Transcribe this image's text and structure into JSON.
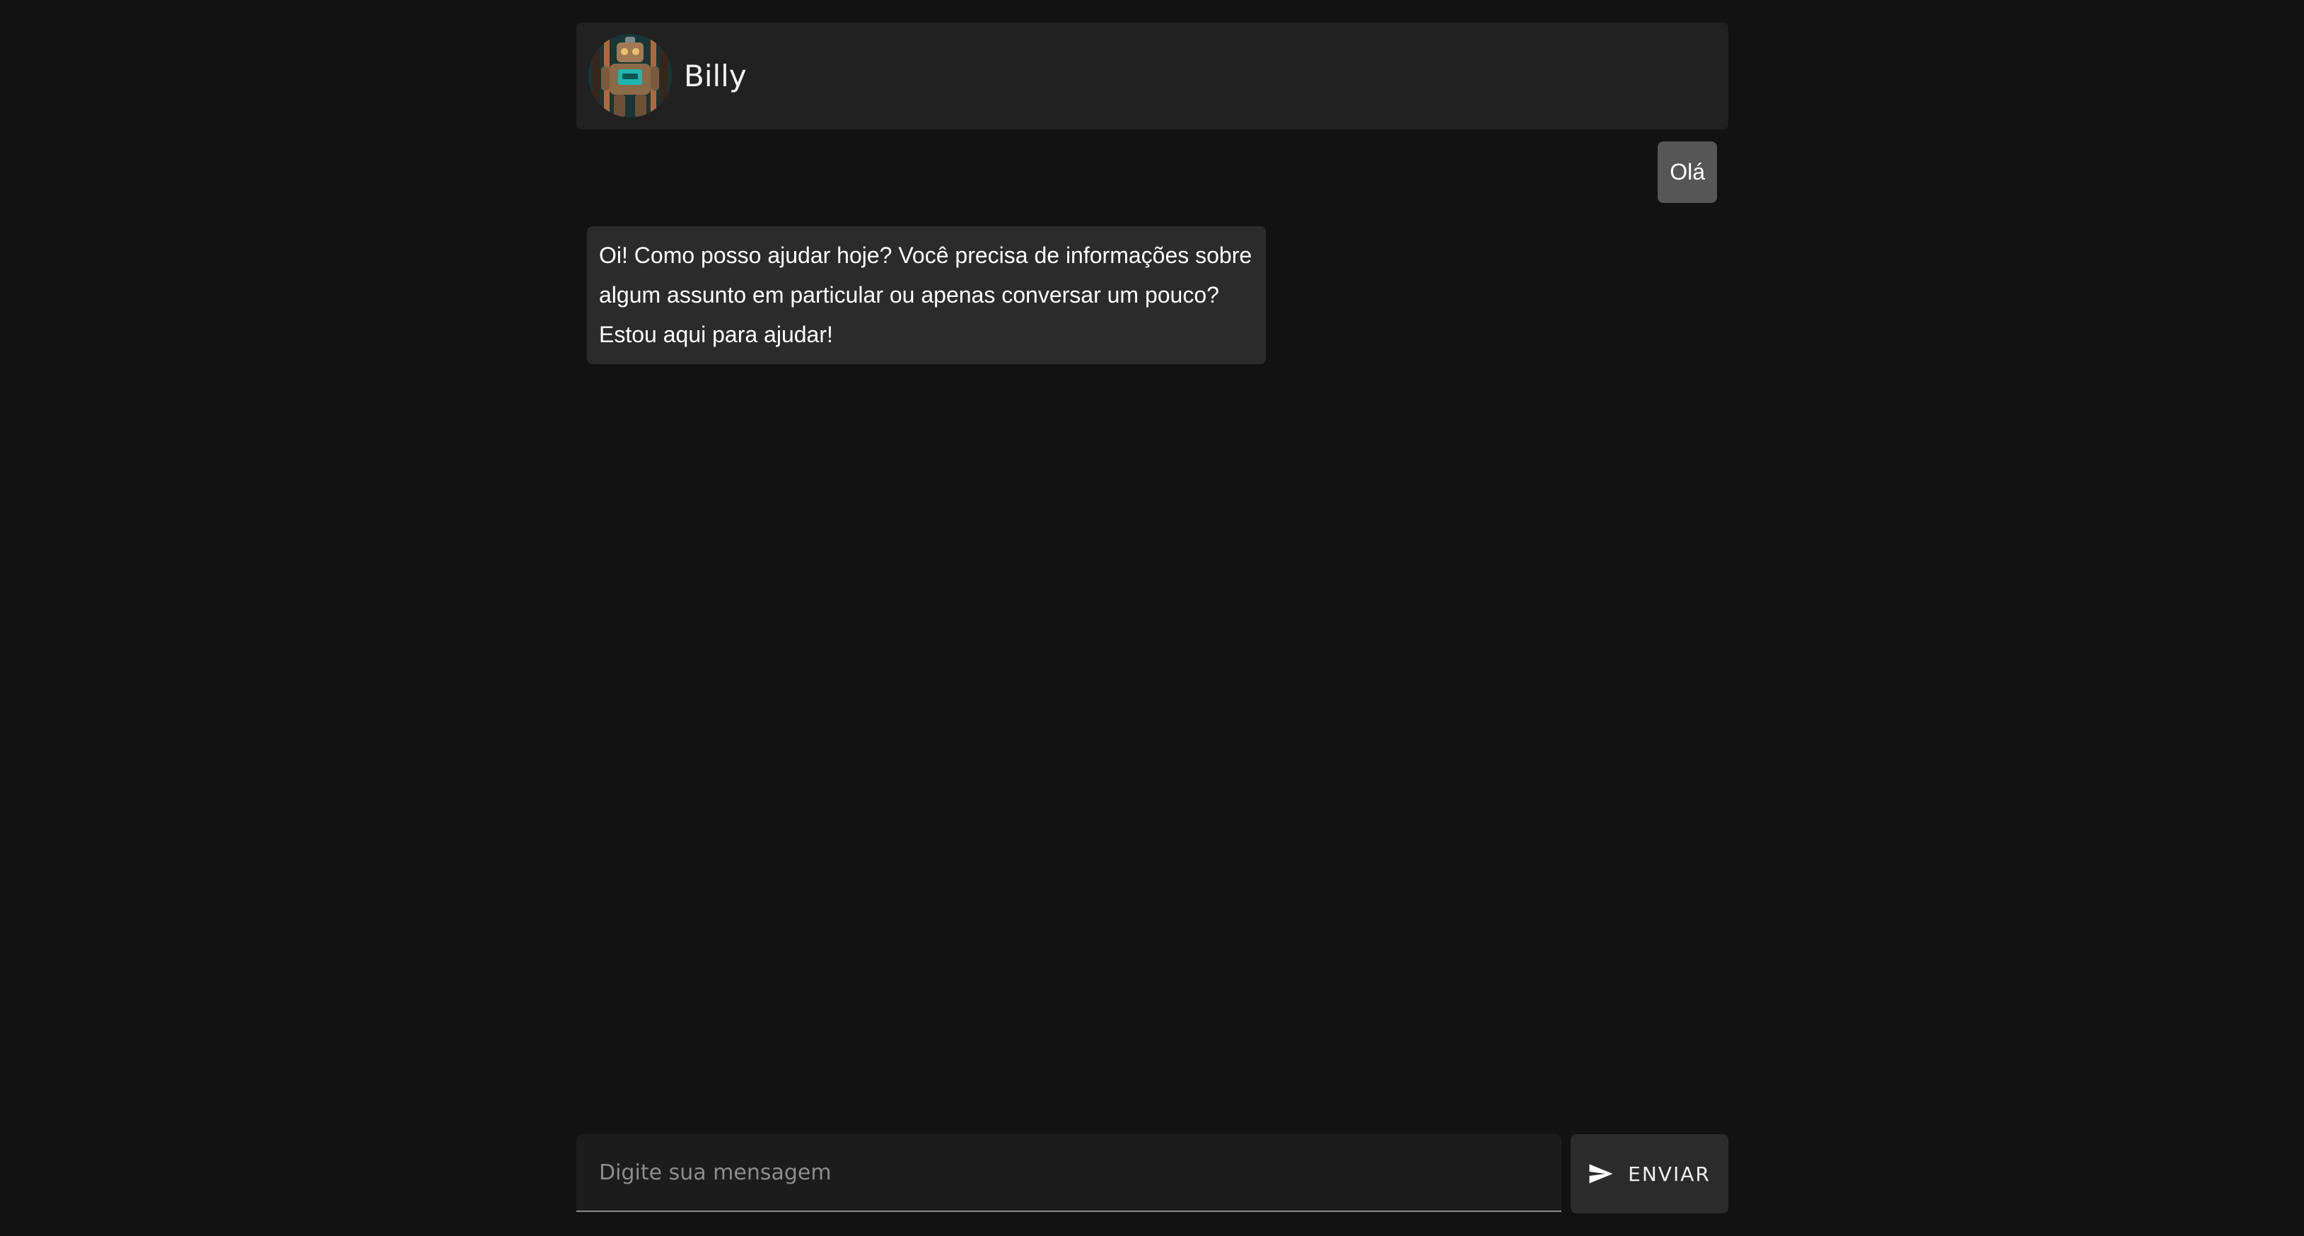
{
  "header": {
    "agent_name": "Billy",
    "avatar_icon": "robot-avatar"
  },
  "messages": [
    {
      "from": "user",
      "text": "Olá"
    },
    {
      "from": "bot",
      "text": "Oi! Como posso ajudar hoje? Você precisa de informações sobre algum assunto em particular ou apenas conversar um pouco? Estou aqui para ajudar!"
    }
  ],
  "composer": {
    "placeholder": "Digite sua mensagem",
    "value": "",
    "send_label": "ENVIAR",
    "send_icon": "send-icon"
  },
  "colors": {
    "background": "#121212",
    "header": "#212121",
    "user_bubble": "#565656",
    "bot_bubble": "#2b2b2b"
  }
}
